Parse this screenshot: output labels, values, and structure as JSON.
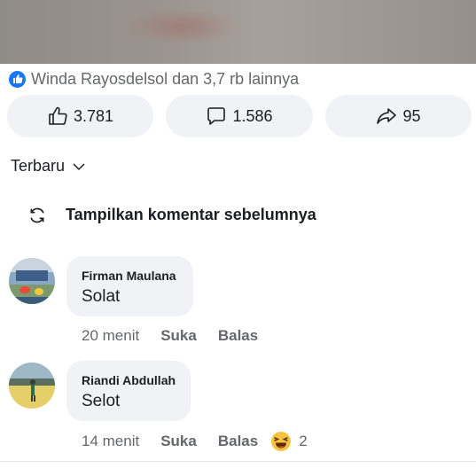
{
  "reactions": {
    "summary": "Winda Rayosdelsol dan 3,7 rb lainnya",
    "icon": "like-badge-icon",
    "accent": "#1877f2"
  },
  "actions": {
    "like": {
      "icon": "thumbs-up-icon",
      "count": "3.781"
    },
    "comment": {
      "icon": "comment-icon",
      "count": "1.586"
    },
    "share": {
      "icon": "share-icon",
      "count": "95"
    }
  },
  "sort": {
    "label": "Terbaru",
    "icon": "chevron-down-icon"
  },
  "previous_comments": {
    "label": "Tampilkan komentar sebelumnya",
    "icon": "refresh-icon"
  },
  "comments": [
    {
      "author": "Firman Maulana",
      "text": "Solat",
      "time": "20 menit",
      "like_label": "Suka",
      "reply_label": "Balas"
    },
    {
      "author": "Riandi Abdullah",
      "text": "Selot",
      "time": "14 menit",
      "like_label": "Suka",
      "reply_label": "Balas",
      "reaction_icon": "laughing-emoji-icon",
      "reaction_count": "2"
    }
  ]
}
